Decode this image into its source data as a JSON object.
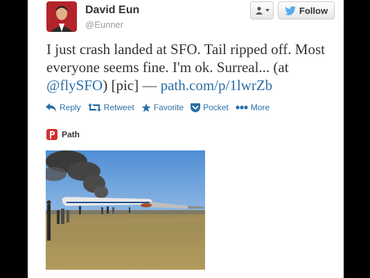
{
  "user": {
    "name": "David Eun",
    "handle": "@Eunner"
  },
  "follow_label": "Follow",
  "tweet": {
    "part1": "I just crash landed at SFO. Tail ripped off. Most everyone seems fine. I'm ok. Surreal... (at ",
    "mention": "@flySFO",
    "part2": ") [pic] — ",
    "link": "path.com/p/1lwrZb"
  },
  "actions": {
    "reply": "Reply",
    "retweet": "Retweet",
    "favorite": "Favorite",
    "pocket": "Pocket",
    "more": "More"
  },
  "attribution": "Path",
  "colors": {
    "link": "#2a6ea6",
    "twitter_blue": "#55acee",
    "path_red": "#d32f2f"
  }
}
